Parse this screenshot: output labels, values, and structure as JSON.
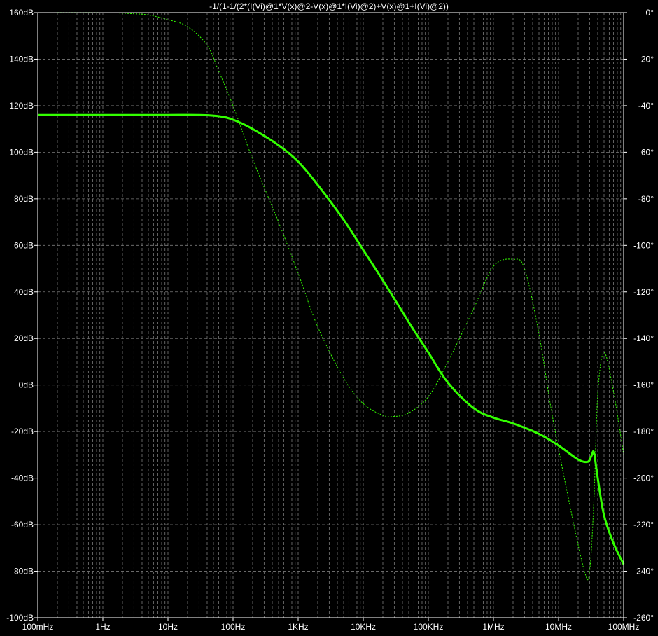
{
  "chart_data": {
    "type": "line",
    "title": "-1/(1-1/(2*(I(Vi)@1*V(x)@2-V(x)@1*I(Vi)@2)+V(x)@1+I(Vi)@2))",
    "xscale": "log",
    "xlim_hz": [
      0.1,
      100000000
    ],
    "x_tick_labels": [
      "100mHz",
      "1Hz",
      "10Hz",
      "100Hz",
      "1KHz",
      "10KHz",
      "100KHz",
      "1MHz",
      "10MHz",
      "100MHz"
    ],
    "x_tick_values_hz": [
      0.1,
      1,
      10,
      100,
      1000,
      10000,
      100000,
      1000000,
      10000000,
      100000000
    ],
    "left_axis": {
      "unit": "dB",
      "ylim": [
        -100,
        160
      ],
      "tick_labels": [
        "160dB",
        "140dB",
        "120dB",
        "100dB",
        "80dB",
        "60dB",
        "40dB",
        "20dB",
        "0dB",
        "-20dB",
        "-40dB",
        "-60dB",
        "-80dB",
        "-100dB"
      ],
      "tick_values": [
        160,
        140,
        120,
        100,
        80,
        60,
        40,
        20,
        0,
        -20,
        -40,
        -60,
        -80,
        -100
      ]
    },
    "right_axis": {
      "unit": "deg",
      "ylim": [
        -260,
        0
      ],
      "tick_labels": [
        "0°",
        "-20°",
        "-40°",
        "-60°",
        "-80°",
        "-100°",
        "-120°",
        "-140°",
        "-160°",
        "-180°",
        "-200°",
        "-220°",
        "-240°",
        "-260°"
      ],
      "tick_values": [
        0,
        -20,
        -40,
        -60,
        -80,
        -100,
        -120,
        -140,
        -160,
        -180,
        -200,
        -220,
        -240,
        -260
      ]
    },
    "grid": true,
    "colors": {
      "background": "#000000",
      "grid": "#7a7a7a",
      "trace": "#33ff00",
      "text": "#ffffff"
    },
    "series": [
      {
        "axis": "left",
        "style": "solid",
        "x": [
          0.1,
          1,
          10,
          30,
          60,
          100,
          200,
          500,
          1000,
          2000,
          5000,
          10000,
          20000,
          50000,
          100000,
          200000,
          500000,
          1000000,
          2000000,
          5000000,
          10000000,
          20000000,
          28000000,
          32000000,
          35000000,
          40000000,
          50000000,
          70000000,
          100000000
        ],
        "y": [
          116,
          116,
          116,
          116,
          115.5,
          114,
          110,
          103,
          96,
          86,
          71,
          58,
          45,
          27,
          14,
          1,
          -10,
          -14,
          -16.5,
          -21,
          -26,
          -32,
          -33,
          -30.5,
          -29,
          -40,
          -56,
          -68,
          -77
        ]
      },
      {
        "axis": "right",
        "style": "dashed-thin",
        "x": [
          0.1,
          1,
          3,
          5,
          10,
          20,
          40,
          60,
          100,
          200,
          500,
          1000,
          2000,
          5000,
          10000,
          20000,
          30000,
          50000,
          100000,
          200000,
          500000,
          1000000,
          2000000,
          3000000,
          5000000,
          8000000,
          15000000,
          25000000,
          30000000,
          35000000,
          40000000,
          50000000,
          70000000,
          100000000
        ],
        "y": [
          0,
          0,
          -0.5,
          -1,
          -3,
          -6,
          -14,
          -25,
          -40,
          -63,
          -90,
          -112,
          -135,
          -157,
          -168,
          -173,
          -173.5,
          -172,
          -165,
          -150,
          -127,
          -109,
          -106,
          -110,
          -138,
          -173,
          -212,
          -240,
          -240,
          -209,
          -164,
          -146,
          -163,
          -190
        ]
      }
    ]
  }
}
